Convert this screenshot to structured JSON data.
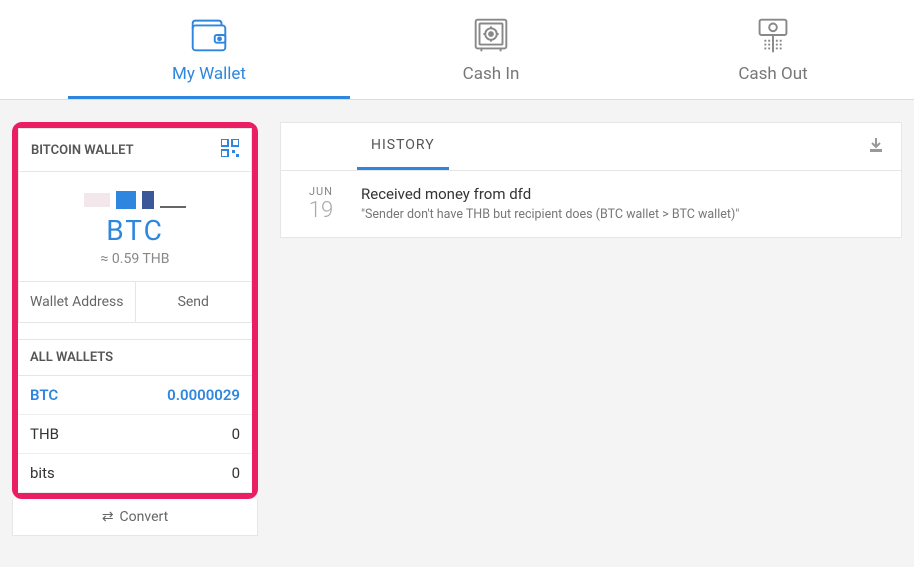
{
  "nav": {
    "my_wallet": "My Wallet",
    "cash_in": "Cash In",
    "cash_out": "Cash Out"
  },
  "bitcoin_wallet": {
    "header": "BITCOIN WALLET",
    "currency": "BTC",
    "approx": "≈ 0.59 THB",
    "wallet_address_btn": "Wallet Address",
    "send_btn": "Send"
  },
  "all_wallets": {
    "header": "ALL WALLETS",
    "rows": [
      {
        "label": "BTC",
        "value": "0.0000029",
        "active": true
      },
      {
        "label": "THB",
        "value": "0",
        "active": false
      },
      {
        "label": "bits",
        "value": "0",
        "active": false
      }
    ],
    "convert": "Convert"
  },
  "history": {
    "tab": "HISTORY",
    "items": [
      {
        "month": "JUN",
        "day": "19",
        "title": "Received money from dfd",
        "subtitle": "\"Sender don't have THB but recipient does (BTC wallet > BTC wallet)\""
      }
    ]
  }
}
